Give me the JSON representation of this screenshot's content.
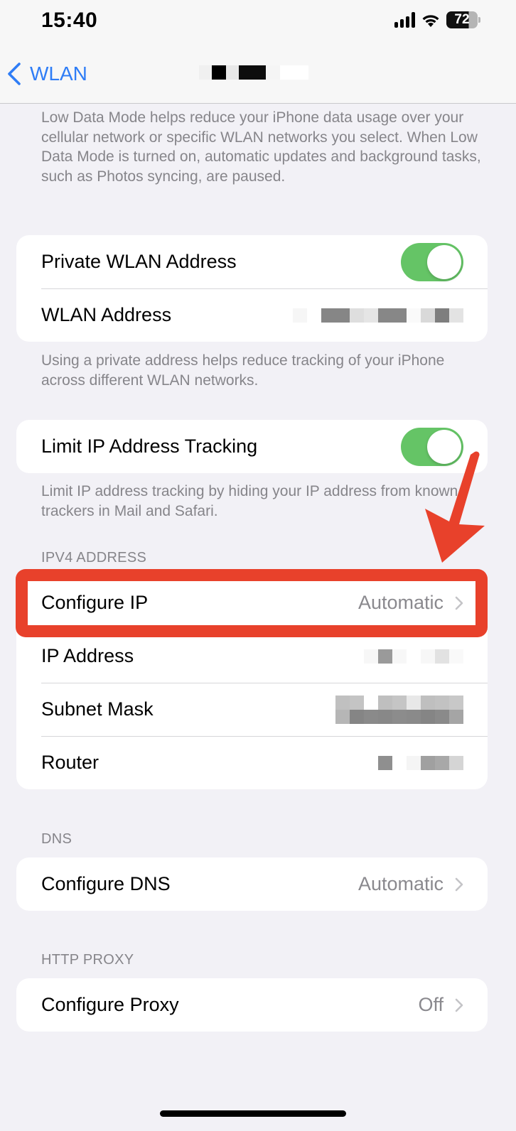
{
  "status_bar": {
    "time": "15:40",
    "battery_percent": "72",
    "icons": [
      "signal-icon",
      "wifi-icon",
      "battery-icon"
    ]
  },
  "nav": {
    "back_label": "WLAN",
    "back_icon": "chevron-left-icon",
    "title": "[redacted network name]"
  },
  "low_data_footer": "Low Data Mode helps reduce your iPhone data usage over your cellular network or specific WLAN networks you select. When Low Data Mode is turned on, automatic updates and background tasks, such as Photos syncing, are paused.",
  "private_address_group": {
    "rows": [
      {
        "label": "Private WLAN Address",
        "toggle_on": true
      },
      {
        "label": "WLAN Address",
        "value": "[redacted]"
      }
    ],
    "footer": "Using a private address helps reduce tracking of your iPhone across different WLAN networks."
  },
  "limit_tracking_group": {
    "rows": [
      {
        "label": "Limit IP Address Tracking",
        "toggle_on": true
      }
    ],
    "footer": "Limit IP address tracking by hiding your IP address from known trackers in Mail and Safari."
  },
  "ipv4_section": {
    "header": "IPV4 ADDRESS",
    "rows": [
      {
        "label": "Configure IP",
        "value": "Automatic",
        "chevron": true,
        "highlighted": true
      },
      {
        "label": "IP Address",
        "value": "[redacted]"
      },
      {
        "label": "Subnet Mask",
        "value": "[redacted]"
      },
      {
        "label": "Router",
        "value": "[redacted]"
      }
    ]
  },
  "dns_section": {
    "header": "DNS",
    "rows": [
      {
        "label": "Configure DNS",
        "value": "Automatic",
        "chevron": true
      }
    ]
  },
  "proxy_section": {
    "header": "HTTP PROXY",
    "rows": [
      {
        "label": "Configure Proxy",
        "value": "Off",
        "chevron": true
      }
    ]
  },
  "annotations": {
    "highlight_color": "#e8412b",
    "arrow_color": "#e8412b",
    "toggle_on_color": "#65c466",
    "accent_color": "#2f7df6"
  }
}
